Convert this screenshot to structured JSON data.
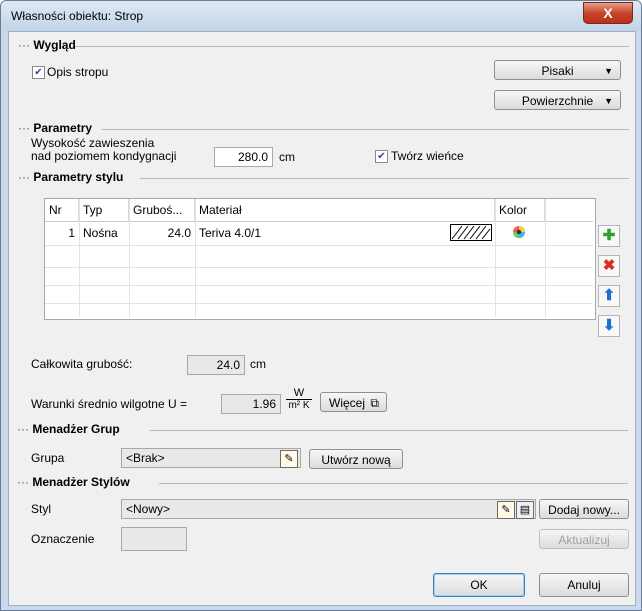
{
  "window": {
    "title": "Własności obiektu: Strop",
    "close_glyph": "X"
  },
  "wyglad": {
    "label": "Wygląd",
    "opis_stropu": {
      "label": "Opis stropu",
      "checked": true
    },
    "pisaki_button": "Pisaki",
    "powierzchnie_button": "Powierzchnie"
  },
  "parametry": {
    "label": "Parametry",
    "height_label_line1": "Wysokość zawieszenia",
    "height_label_line2": "nad poziomem kondygnacji",
    "height_value": "280.0",
    "height_unit": "cm",
    "tworz_wience": {
      "label": "Twórz wieńce",
      "checked": true
    }
  },
  "parametry_stylu": {
    "label": "Parametry stylu",
    "columns": [
      "Nr",
      "Typ",
      "Gruboś...",
      "Materiał",
      "Kolor"
    ],
    "rows": [
      {
        "nr": "1",
        "typ": "Nośna",
        "grubosc": "24.0",
        "material": "Teriva 4.0/1"
      }
    ],
    "total_label": "Całkowita grubość:",
    "total_value": "24.0",
    "total_unit": "cm",
    "u_label": "Warunki średnio wilgotne U =",
    "u_value": "1.96",
    "u_unit_num": "W",
    "u_unit_den": "m² K",
    "wiecej_button": "Więcej"
  },
  "menadzer_grup": {
    "label": "Menadżer Grup",
    "grupa_label": "Grupa",
    "grupa_value": "<Brak>",
    "utworz_button": "Utwórz nową"
  },
  "menadzer_stylow": {
    "label": "Menadżer Stylów",
    "styl_label": "Styl",
    "styl_value": "<Nowy>",
    "dodaj_button": "Dodaj nowy...",
    "oznaczenie_label": "Oznaczenie",
    "oznaczenie_value": "",
    "aktualizuj_button": "Aktualizuj"
  },
  "footer": {
    "ok_button": "OK",
    "cancel_button": "Anuluj"
  },
  "section_dots": "···",
  "icons": {
    "add": "plus-icon",
    "delete": "cross-icon",
    "up": "arrow-up-icon",
    "down": "arrow-down-icon",
    "color": "color-wheel-icon",
    "hatch": "hatch-pattern-icon",
    "edit": "edit-icon",
    "library": "library-icon",
    "more": "open-window-icon"
  },
  "colors": {
    "add": "#2ea02e",
    "delete": "#d83020",
    "arrows": "#1a6fd0",
    "close": "#c8452c"
  }
}
